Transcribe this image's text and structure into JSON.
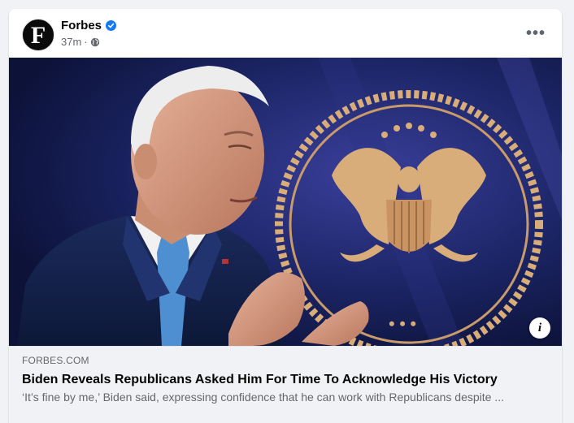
{
  "post": {
    "page_name": "Forbes",
    "avatar_letter": "F",
    "timestamp": "37m",
    "separator": "·",
    "verified_icon": "verified-badge-icon",
    "privacy_icon": "globe-icon",
    "more_icon": "more-options-icon",
    "more_label": "•••"
  },
  "link_preview": {
    "domain": "FORBES.COM",
    "headline": "Biden Reveals Republicans Asked Him For Time To Acknowledge His Victory",
    "description": "‘It’s fine by me,’ Biden said, expressing confidence that he can work with Republicans despite ...",
    "info_label": "i"
  },
  "colors": {
    "accent": "#1877f2",
    "background": "#f0f2f5",
    "text_primary": "#050505",
    "text_secondary": "#65676b",
    "seal_gold": "#d9ad7a",
    "photo_backdrop": "#15205a"
  }
}
